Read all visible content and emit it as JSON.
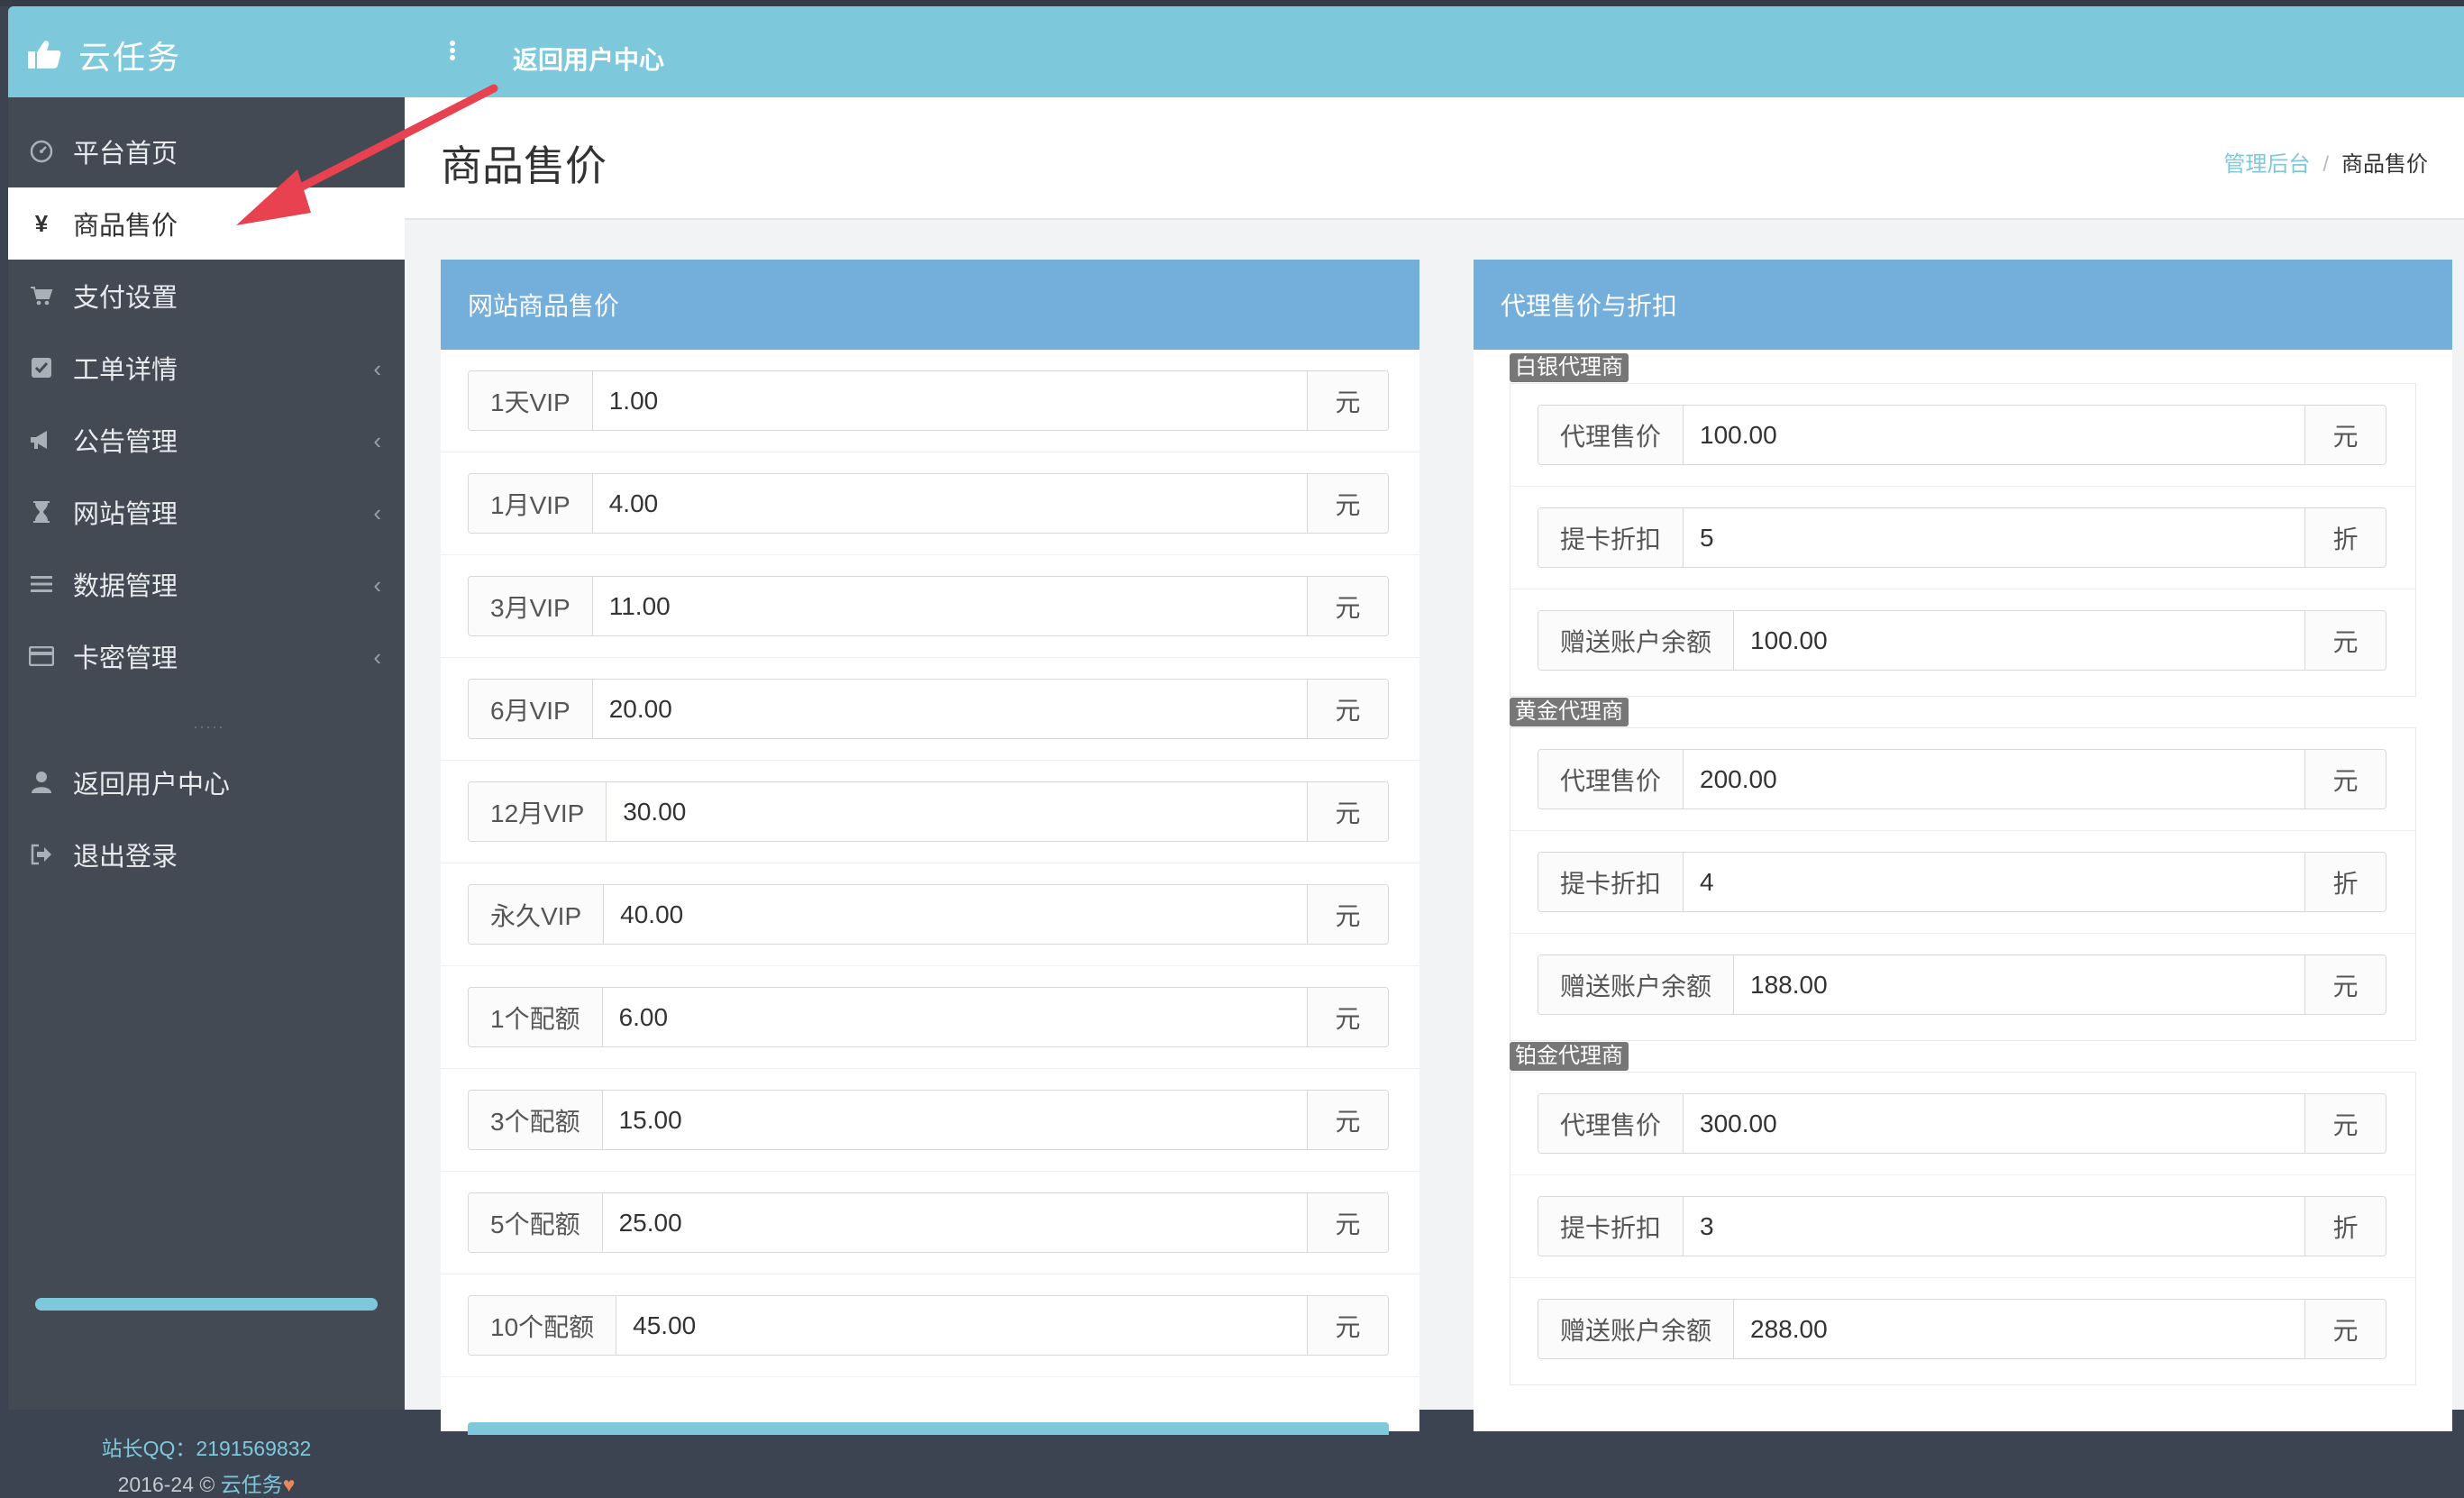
{
  "app": {
    "brand": "云任务",
    "back_link": "返回用户中心"
  },
  "sidebar": {
    "items": [
      {
        "label": "平台首页",
        "icon": "dashboard-icon"
      },
      {
        "label": "商品售价",
        "icon": "yen-icon",
        "active": true
      },
      {
        "label": "支付设置",
        "icon": "cart-icon"
      },
      {
        "label": "工单详情",
        "icon": "checkbox-icon",
        "has_submenu": true
      },
      {
        "label": "公告管理",
        "icon": "megaphone-icon",
        "has_submenu": true
      },
      {
        "label": "网站管理",
        "icon": "hourglass-icon",
        "has_submenu": true
      },
      {
        "label": "数据管理",
        "icon": "list-icon",
        "has_submenu": true
      },
      {
        "label": "卡密管理",
        "icon": "credit-card-icon",
        "has_submenu": true
      }
    ],
    "divider_dots": "·····",
    "bottom_items": [
      {
        "label": "返回用户中心",
        "icon": "user-icon"
      },
      {
        "label": "退出登录",
        "icon": "sign-out-icon"
      }
    ],
    "footer": {
      "qq_text": "站长QQ：2191569832",
      "copyright_prefix": "2016-24 © ",
      "copyright_brand": "云任务",
      "heart": "♥"
    }
  },
  "page": {
    "title": "商品售价",
    "breadcrumb": {
      "home": "管理后台",
      "separator": "/",
      "current": "商品售价"
    }
  },
  "website_prices": {
    "title": "网站商品售价",
    "rows": [
      {
        "label": "1天VIP",
        "value": "1.00",
        "unit": "元"
      },
      {
        "label": "1月VIP",
        "value": "4.00",
        "unit": "元"
      },
      {
        "label": "3月VIP",
        "value": "11.00",
        "unit": "元"
      },
      {
        "label": "6月VIP",
        "value": "20.00",
        "unit": "元"
      },
      {
        "label": "12月VIP",
        "value": "30.00",
        "unit": "元"
      },
      {
        "label": "永久VIP",
        "value": "40.00",
        "unit": "元"
      },
      {
        "label": "1个配额",
        "value": "6.00",
        "unit": "元"
      },
      {
        "label": "3个配额",
        "value": "15.00",
        "unit": "元"
      },
      {
        "label": "5个配额",
        "value": "25.00",
        "unit": "元"
      },
      {
        "label": "10个配额",
        "value": "45.00",
        "unit": "元"
      }
    ]
  },
  "agent_prices": {
    "title": "代理售价与折扣",
    "tiers": [
      {
        "name": "白银代理商",
        "rows": [
          {
            "label": "代理售价",
            "value": "100.00",
            "unit": "元"
          },
          {
            "label": "提卡折扣",
            "value": "5",
            "unit": "折"
          },
          {
            "label": "赠送账户余额",
            "value": "100.00",
            "unit": "元"
          }
        ]
      },
      {
        "name": "黄金代理商",
        "rows": [
          {
            "label": "代理售价",
            "value": "200.00",
            "unit": "元"
          },
          {
            "label": "提卡折扣",
            "value": "4",
            "unit": "折"
          },
          {
            "label": "赠送账户余额",
            "value": "188.00",
            "unit": "元"
          }
        ]
      },
      {
        "name": "铂金代理商",
        "rows": [
          {
            "label": "代理售价",
            "value": "300.00",
            "unit": "元"
          },
          {
            "label": "提卡折扣",
            "value": "3",
            "unit": "折"
          },
          {
            "label": "赠送账户余额",
            "value": "288.00",
            "unit": "元"
          }
        ]
      }
    ]
  },
  "colors": {
    "header": "#7ec8dc",
    "panel_head": "#74aedb",
    "sidebar": "#434a54",
    "arrow": "#e8414f"
  }
}
